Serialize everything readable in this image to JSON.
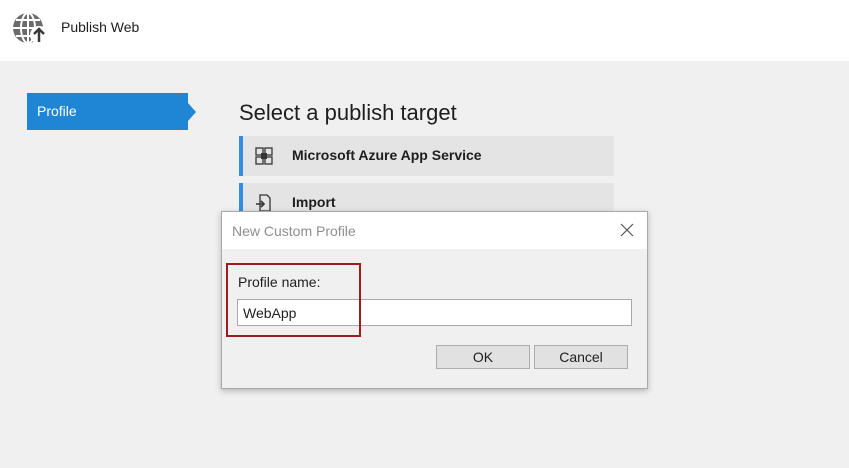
{
  "window": {
    "title": "Publish Web",
    "icon": "globe-publish-icon"
  },
  "nav": {
    "items": [
      {
        "label": "Profile",
        "selected": true
      }
    ]
  },
  "main": {
    "heading": "Select a publish target",
    "targets": [
      {
        "label": "Microsoft Azure App Service",
        "icon": "azure-app-service-icon"
      },
      {
        "label": "Import",
        "icon": "import-icon"
      }
    ]
  },
  "dialog": {
    "title": "New Custom Profile",
    "field_label": "Profile name:",
    "field_value": "WebApp",
    "ok_label": "OK",
    "cancel_label": "Cancel"
  },
  "colors": {
    "accent": "#1f86d6",
    "highlight": "#a11a1f"
  }
}
